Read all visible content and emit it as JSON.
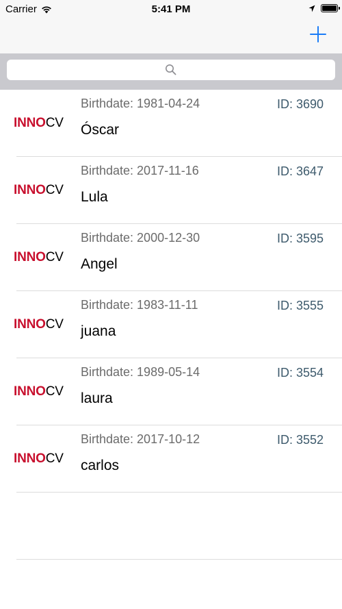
{
  "status_bar": {
    "carrier": "Carrier",
    "time": "5:41 PM"
  },
  "nav_bar": {
    "add_icon": "plus-icon",
    "accent_color": "#1a7cf7"
  },
  "search": {
    "placeholder": "",
    "icon": "search-icon"
  },
  "logo": {
    "part1": "INNO",
    "part2": "CV",
    "brand_color": "#c8102e"
  },
  "users": [
    {
      "birthdate": "Birthdate: 1981-04-24",
      "id": "ID: 3690",
      "name": "Óscar"
    },
    {
      "birthdate": "Birthdate: 2017-11-16",
      "id": "ID: 3647",
      "name": "Lula"
    },
    {
      "birthdate": "Birthdate: 2000-12-30",
      "id": "ID: 3595",
      "name": "Angel"
    },
    {
      "birthdate": "Birthdate: 1983-11-11",
      "id": "ID: 3555",
      "name": "juana"
    },
    {
      "birthdate": "Birthdate: 1989-05-14",
      "id": "ID: 3554",
      "name": "laura"
    },
    {
      "birthdate": "Birthdate: 2017-10-12",
      "id": "ID: 3552",
      "name": "carlos"
    }
  ]
}
